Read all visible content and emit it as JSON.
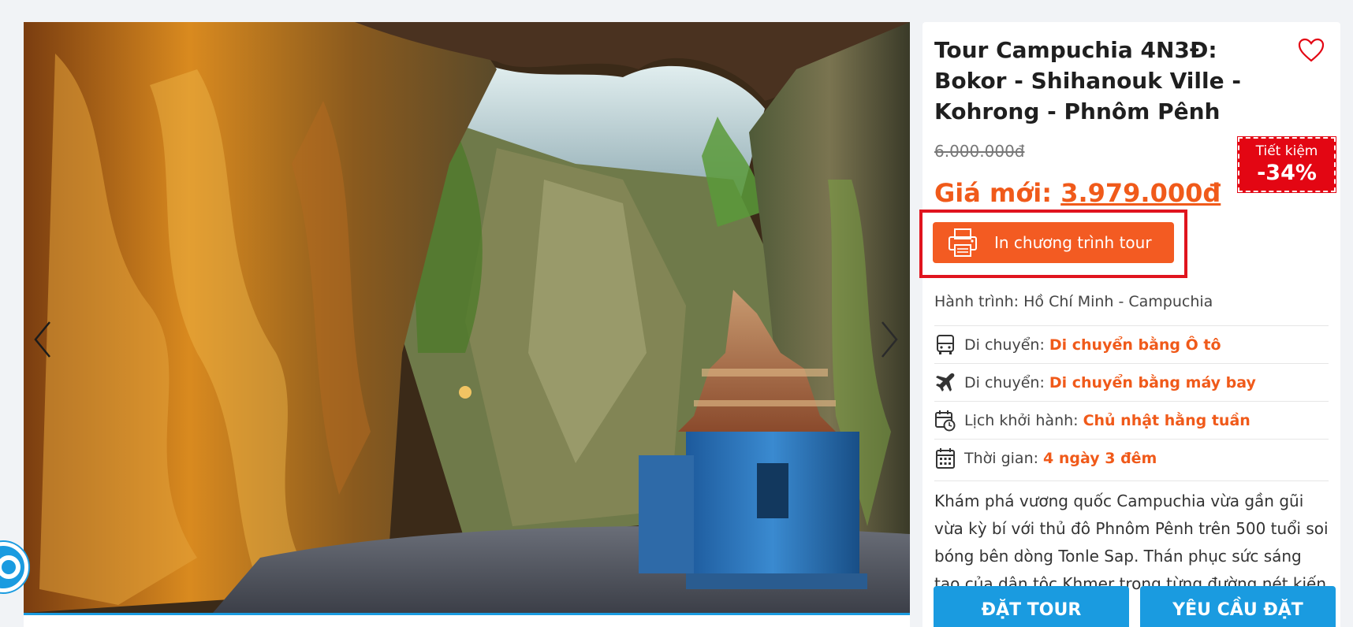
{
  "tour": {
    "title": "Tour Campuchia 4N3Đ: Bokor - Shihanouk Ville - Kohrong - Phnôm Pênh",
    "old_price": "6.000.000đ",
    "new_price_label": "Giá mới:",
    "new_price_value": "3.979.000đ",
    "save_label": "Tiết kiệm",
    "save_percent": "-34%",
    "print_button": "In chương trình tour",
    "route": "Hành trình: Hồ Chí Minh - Campuchia",
    "details": [
      {
        "icon": "bus-icon",
        "label": "Di chuyển:",
        "value": "Di chuyển bằng Ô tô"
      },
      {
        "icon": "airplane-icon",
        "label": "Di chuyển:",
        "value": "Di chuyển bằng máy bay"
      },
      {
        "icon": "calendar-clock-icon",
        "label": "Lịch khởi hành:",
        "value": "Chủ nhật hằng tuần"
      },
      {
        "icon": "calendar-icon",
        "label": "Thời gian:",
        "value": "4 ngày 3 đêm"
      }
    ],
    "description": "Khám phá vương quốc Campuchia vừa gần gũi vừa kỳ bí với thủ đô Phnôm Pênh trên 500 tuổi soi bóng bên dòng Tonle Sap. Thán phục sức sáng tạo của dân tộc Khmer trong từng đường nét kiến trúc...",
    "book_button": "ĐẶT TOUR",
    "request_button": "YÊU CẦU ĐẶT"
  },
  "colors": {
    "accent_orange": "#f35b22",
    "price_orange": "#f05a1a",
    "cta_blue": "#1a9be0",
    "badge_red": "#e30613",
    "highlight_red": "#e0141e"
  }
}
